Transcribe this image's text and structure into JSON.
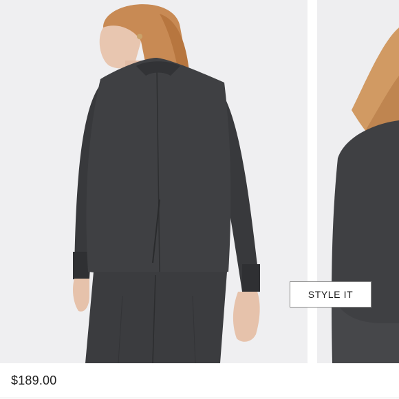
{
  "product": {
    "style_it_label": "STYLE IT",
    "price": "$189.00"
  },
  "colors": {
    "background": "#efeff1",
    "jacket": "#3f4043",
    "hair": "#c88a54",
    "skin": "#e8c6b0"
  }
}
